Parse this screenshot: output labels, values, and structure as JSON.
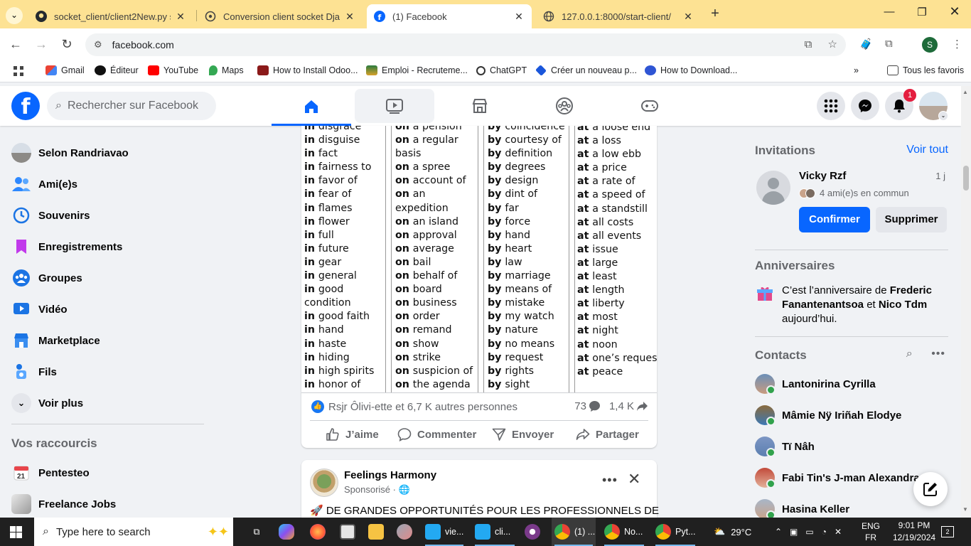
{
  "browser": {
    "tabs": [
      {
        "title": "socket_client/client2New.py su",
        "active": false
      },
      {
        "title": "Conversion client socket Djang",
        "active": false
      },
      {
        "title": "(1) Facebook",
        "active": true
      },
      {
        "title": "127.0.0.1:8000/start-client/",
        "active": false
      }
    ],
    "url": "facebook.com",
    "profile_initial": "S",
    "bookmarks": [
      "Gmail",
      "Éditeur",
      "YouTube",
      "Maps",
      "How to Install Odoo...",
      "Emploi - Recruteme...",
      "ChatGPT",
      "Créer un nouveau p...",
      "How to Download..."
    ],
    "all_bookmarks": "Tous les favoris"
  },
  "fb": {
    "search_placeholder": "Rechercher sur Facebook",
    "notif_count": "1",
    "accent": "#0866ff"
  },
  "left_nav": {
    "items": [
      {
        "label": "Selon Randriavao",
        "icon": "user-avatar"
      },
      {
        "label": "Ami(e)s",
        "icon": "friends-icon"
      },
      {
        "label": "Souvenirs",
        "icon": "memories-icon"
      },
      {
        "label": "Enregistrements",
        "icon": "bookmark-icon"
      },
      {
        "label": "Groupes",
        "icon": "groups-icon"
      },
      {
        "label": "Vidéo",
        "icon": "video-icon"
      },
      {
        "label": "Marketplace",
        "icon": "marketplace-icon"
      },
      {
        "label": "Fils",
        "icon": "feeds-icon"
      },
      {
        "label": "Voir plus",
        "icon": "chevron-down-icon"
      }
    ],
    "shortcuts_title": "Vos raccourcis",
    "shortcuts": [
      {
        "label": "Pentesteo",
        "icon": "calendar-icon"
      },
      {
        "label": "Freelance Jobs",
        "icon": "group-thumb"
      }
    ]
  },
  "post1": {
    "image_columns": [
      [
        "in|disgrace",
        "in|disguise",
        "in|fact",
        "in|fairness to",
        "in|favor of",
        "in|fear of",
        "in|flames",
        "in|flower",
        "in|full",
        "in|future",
        "in|gear",
        "in|general",
        "in|good",
        "|condition",
        "in|good faith",
        "in|hand",
        "in|haste",
        "in|hiding",
        "in|high spirits",
        "in|honor of"
      ],
      [
        "on|a pension",
        "on|a regular",
        "|basis",
        "on|a spree",
        "on|account of",
        "on|an",
        "|expedition",
        "on|an island",
        "on|approval",
        "on|average",
        "on|bail",
        "on|behalf of",
        "on|board",
        "on|business",
        "on|order",
        "on|remand",
        "on|show",
        "on|strike",
        "on|suspicion of",
        "on|the agenda"
      ],
      [
        "by|coincidence",
        "by|courtesy of",
        "by|definition",
        "by|degrees",
        "by|design",
        "by|dint of",
        "by|far",
        "by|force",
        "by|hand",
        "by|heart",
        "by|law",
        "by|marriage",
        "by|means of",
        "by|mistake",
        "by|my watch",
        "by|nature",
        "by|no means",
        "by|request",
        "by|rights",
        "by|sight"
      ],
      [
        "at|a loose end",
        "at|a loss",
        "at|a low ebb",
        "at|a price",
        "at|a rate of",
        "at|a speed of",
        "at|a standstill",
        "at|all costs",
        "at|all events",
        "at|issue",
        "at|large",
        "at|least",
        "at|length",
        "at|liberty",
        "at|most",
        "at|night",
        "at|noon",
        "at|one’s request",
        "at|peace"
      ]
    ],
    "reactions_text": "Rsjr Ôlivi-ette et 6,7 K autres personnes",
    "comments_count": "73",
    "shares_count": "1,4 K",
    "actions": {
      "like": "J’aime",
      "comment": "Commenter",
      "send": "Envoyer",
      "share": "Partager"
    }
  },
  "post2": {
    "page_name": "Feelings Harmony",
    "sponsored": "Sponsorisé ·",
    "text": "🚀 DE GRANDES OPPORTUNITÉS POUR LES PROFESSIONNELS DE"
  },
  "right": {
    "invitations_title": "Invitations",
    "see_all": "Voir tout",
    "request": {
      "name": "Vicky Rzf",
      "time": "1 j",
      "mutual": "4 ami(e)s en commun",
      "confirm": "Confirmer",
      "delete": "Supprimer"
    },
    "birthdays_title": "Anniversaires",
    "birthday": {
      "prefix": "C’est l’anniversaire de ",
      "name1": "Frederic Fanantenantsoa",
      "middle": " et ",
      "name2": "Nico Tdm",
      "suffix": " aujourd’hui."
    },
    "contacts_title": "Contacts",
    "contacts": [
      "Lantonirina Cyrilla",
      "Mâmie Nÿ Iriñah Elodye",
      "Tï Nâh",
      "Fabi Tin's J-man Alexandra",
      "Hasina Keller"
    ]
  },
  "taskbar": {
    "search_placeholder": "Type here to search",
    "apps": [
      "vie...",
      "cli...",
      "(1) ...",
      "No...",
      "Pyt..."
    ],
    "weather": "29°C",
    "lang1": "ENG",
    "lang2": "FR",
    "time": "9:01 PM",
    "date": "12/19/2024",
    "notif": "2"
  }
}
